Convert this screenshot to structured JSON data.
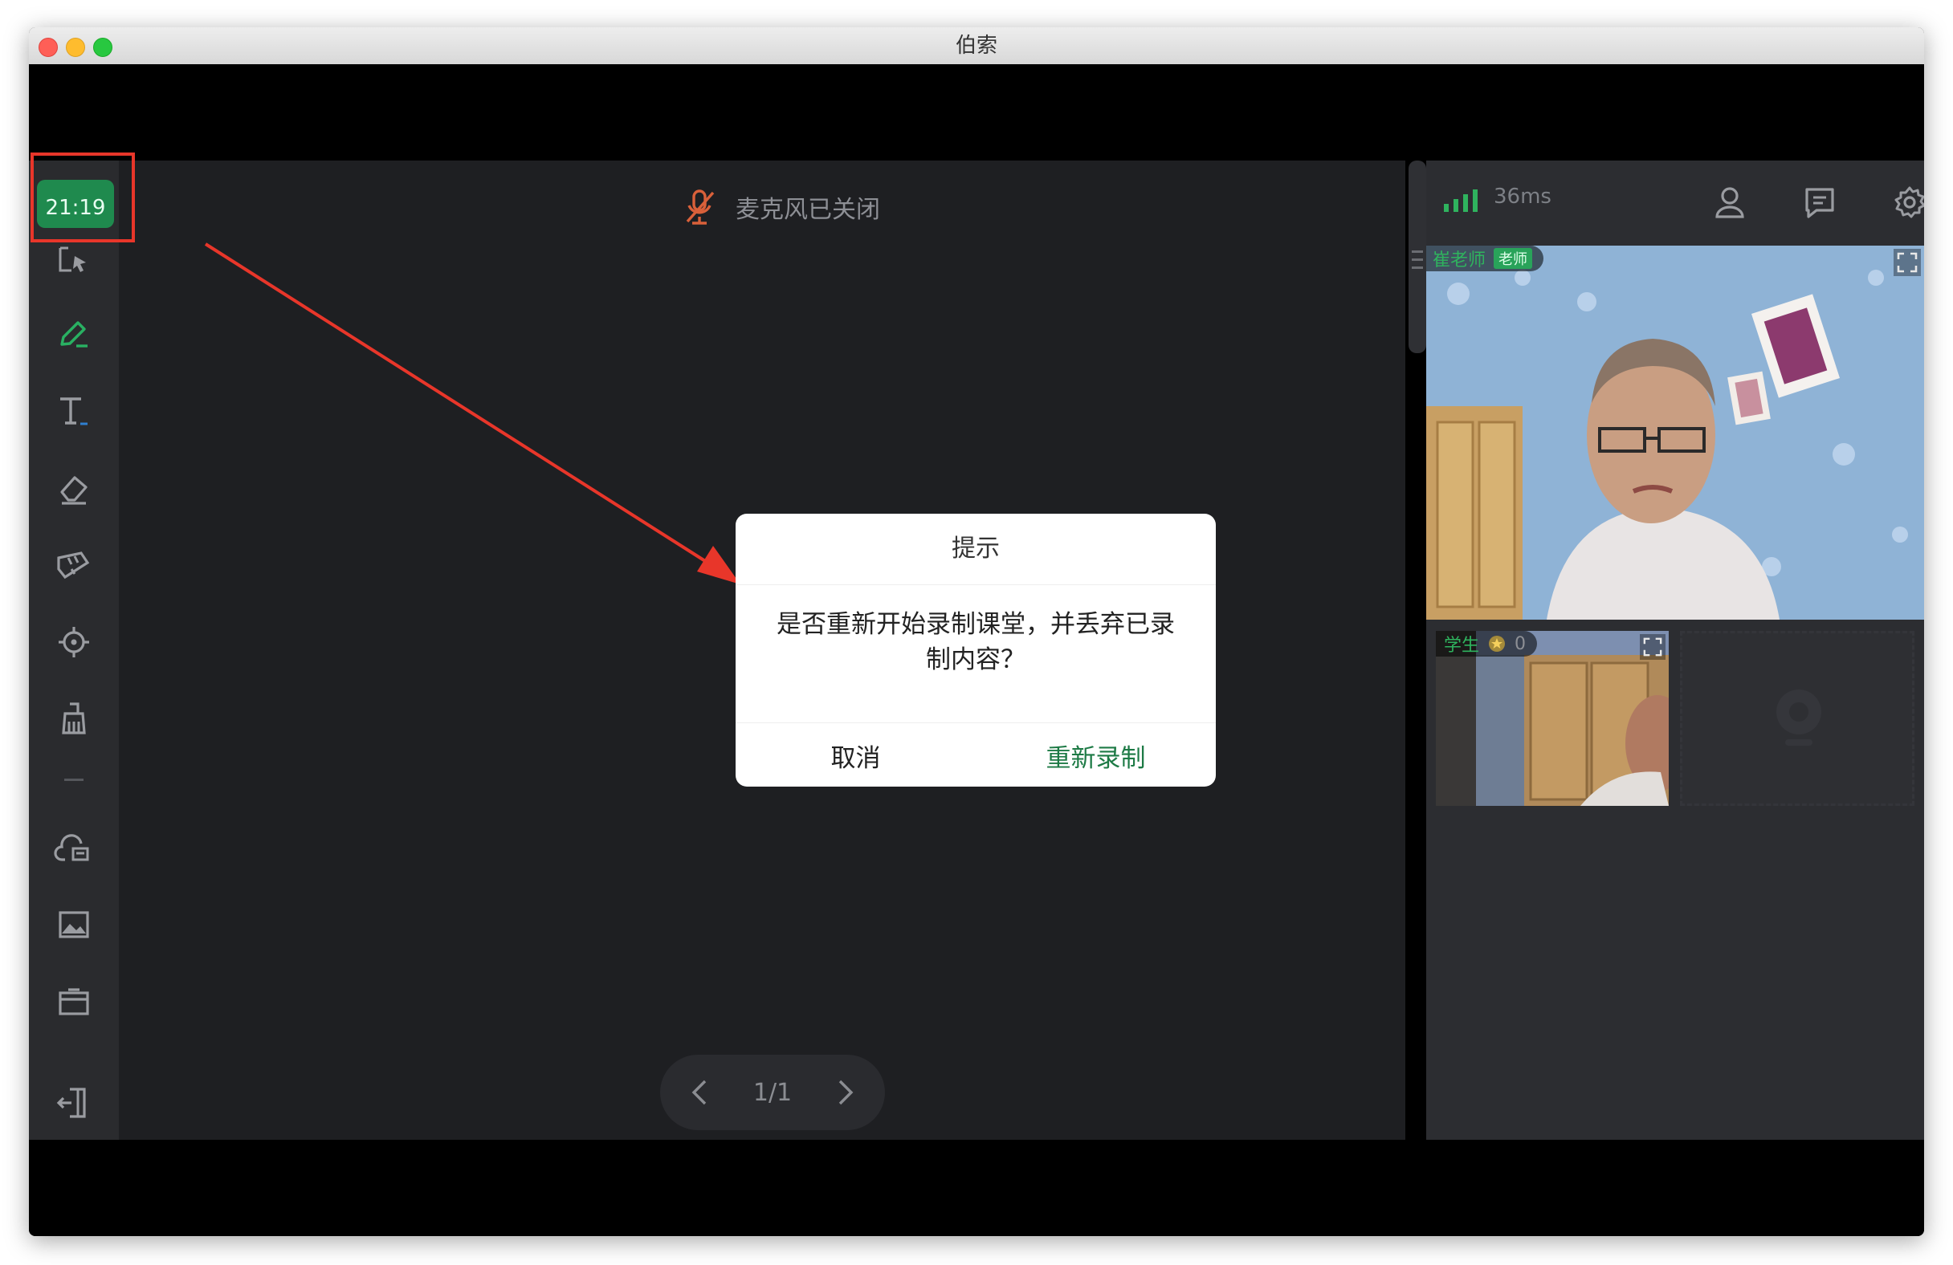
{
  "window": {
    "title": "伯索"
  },
  "toolbar": {
    "timer": "21:19",
    "tools": [
      "select-icon",
      "pen-icon",
      "text-icon",
      "eraser-icon",
      "ruler-icon",
      "laser-pointer-icon",
      "clear-board-icon",
      "cloud-files-icon",
      "image-icon",
      "toolbox-icon",
      "exit-icon"
    ]
  },
  "canvas": {
    "mic_status": "麦克风已关闭",
    "page_indicator": "1/1"
  },
  "dialog": {
    "title": "提示",
    "message": "是否重新开始录制课堂，并丢弃已录制内容？",
    "cancel_label": "取消",
    "confirm_label": "重新录制"
  },
  "right_panel": {
    "network_latency": "36ms",
    "teacher": {
      "name": "崔老师",
      "role_tag": "老师"
    },
    "student": {
      "name": "学生",
      "stars": "0"
    }
  },
  "colors": {
    "accent_green": "#1f8a4e",
    "highlight_red": "#e8362a",
    "confirm_text": "#1d7a45"
  }
}
